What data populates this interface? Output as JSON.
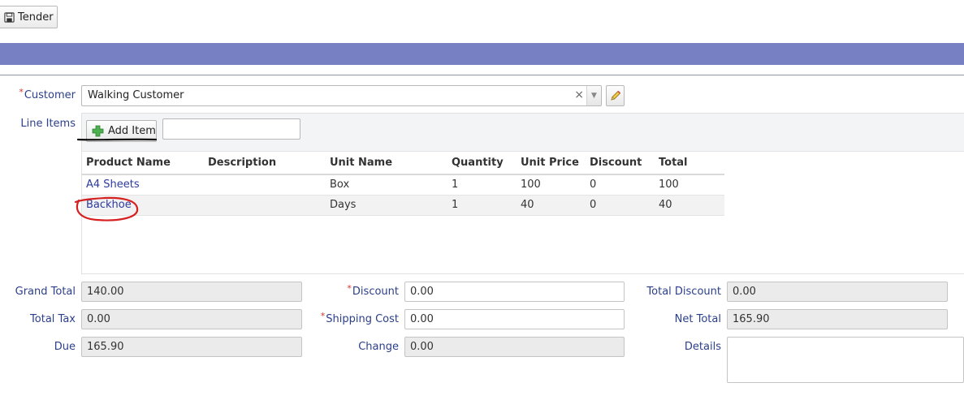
{
  "toolbar": {
    "tender_label": "Tender",
    "tender_icon": "save-icon"
  },
  "colors": {
    "banner": "#7880c4",
    "label": "#2b3f8a",
    "link": "#2d3a9e",
    "required": "#d9342b",
    "annotation_black": "#111111",
    "annotation_red": "#d62020"
  },
  "customer": {
    "label": "Customer",
    "required": "*",
    "value": "Walking Customer"
  },
  "line_items": {
    "label": "Line Items",
    "add_item_label": "Add Item",
    "columns": [
      "Product Name",
      "Description",
      "Unit Name",
      "Quantity",
      "Unit Price",
      "Discount",
      "Total"
    ],
    "rows": [
      {
        "product": "A4 Sheets",
        "description": "",
        "unit": "Box",
        "quantity": "1",
        "unit_price": "100",
        "discount": "0",
        "total": "100"
      },
      {
        "product": "Backhoe",
        "description": "",
        "unit": "Days",
        "quantity": "1",
        "unit_price": "40",
        "discount": "0",
        "total": "40"
      }
    ]
  },
  "totals": {
    "grand_total": {
      "label": "Grand Total",
      "value": "140.00"
    },
    "total_tax": {
      "label": "Total Tax",
      "value": "0.00"
    },
    "due": {
      "label": "Due",
      "value": "165.90"
    },
    "discount": {
      "label": "Discount",
      "required": "*",
      "value": "0.00"
    },
    "shipping_cost": {
      "label": "Shipping Cost",
      "required": "*",
      "value": "0.00"
    },
    "change": {
      "label": "Change",
      "value": "0.00"
    },
    "total_discount": {
      "label": "Total Discount",
      "value": "0.00"
    },
    "net_total": {
      "label": "Net Total",
      "value": "165.90"
    },
    "details": {
      "label": "Details",
      "value": ""
    }
  }
}
